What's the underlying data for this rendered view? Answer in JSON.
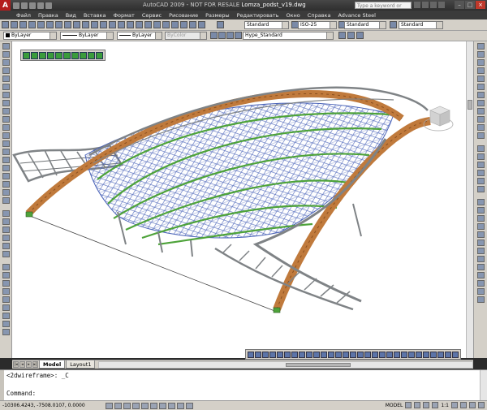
{
  "window": {
    "app_title": "AutoCAD 2009 - NOT FOR RESALE",
    "filename": "Lomza_podst_v19.dwg",
    "search_placeholder": "Type a keyword or phrase",
    "logo_letter": "A"
  },
  "menu": [
    "Файл",
    "Правка",
    "Вид",
    "Вставка",
    "Формат",
    "Сервис",
    "Рисование",
    "Размеры",
    "Редактировать",
    "Окно",
    "Справка",
    "Advance Steel"
  ],
  "toolbar_row1": {
    "text_style": "Standard",
    "dim_style": "ISO-25",
    "table_style": "Standard",
    "multileader_style": "Standard"
  },
  "toolbar_row2": {
    "layer": "ByLayer",
    "linetype": "ByLayer",
    "lineweight": "ByLayer",
    "plot_style": "ByColor",
    "layer_state": "Hype_Standard"
  },
  "layout_tabs": [
    "Model",
    "Layout1"
  ],
  "active_tab": "Model",
  "command": {
    "history": "<2dwireframe>: _C",
    "prompt": "Command:"
  },
  "status": {
    "coordinates": "-10306.4243, -7508.0107, 0.0000",
    "space": "MODEL",
    "annotation_scale": "1:1"
  },
  "colors": {
    "orange_arch": "#c07a3c",
    "green_ring": "#4ea33a",
    "blue_grid": "#4a63b8",
    "gray_truss": "#7f8386",
    "titlebar": "#3b3b3b",
    "toolbar": "#d4d0c8"
  }
}
